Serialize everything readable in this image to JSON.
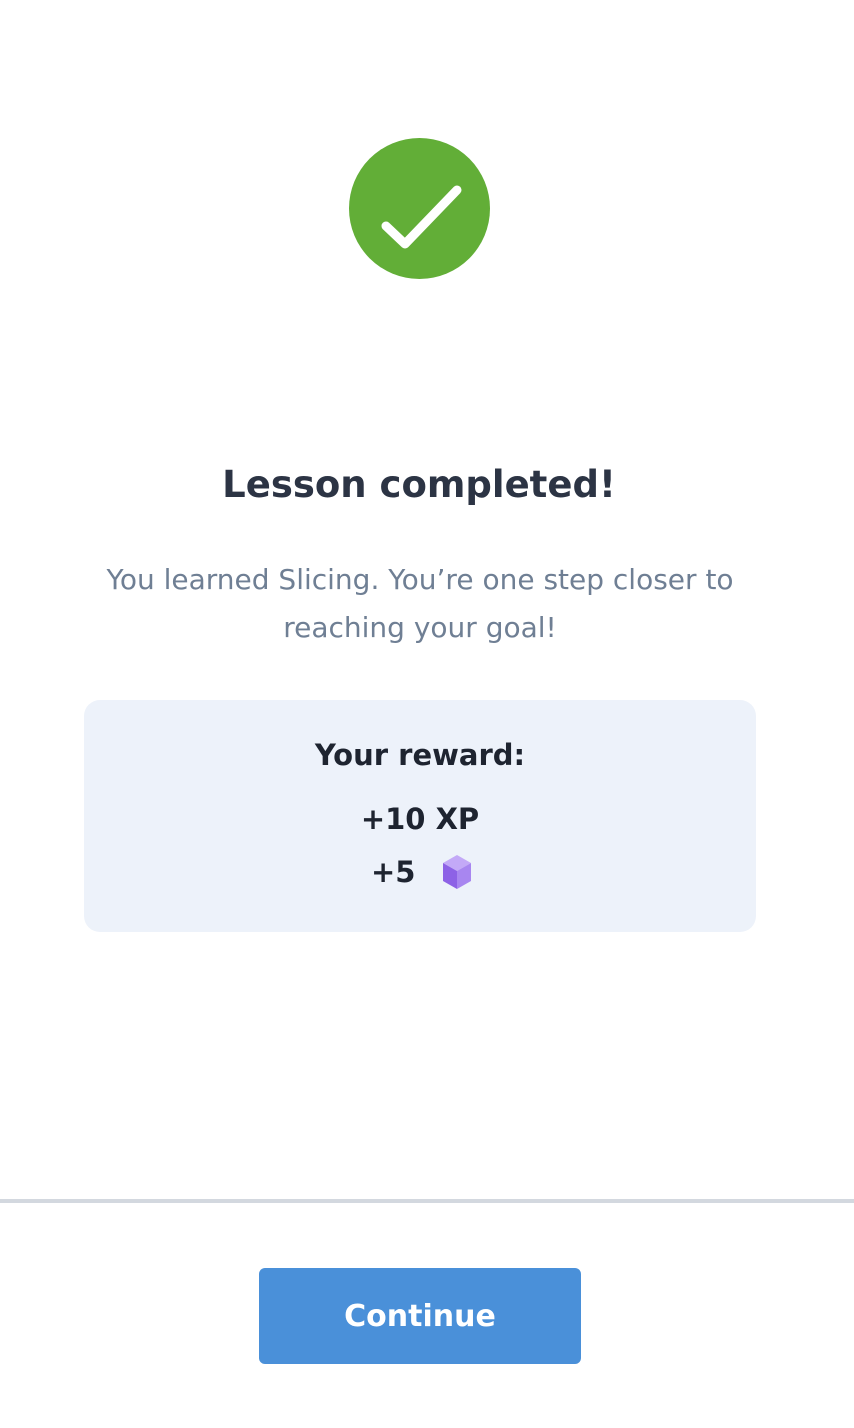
{
  "colors": {
    "success_green": "#62ae37",
    "button_blue": "#4a90d9",
    "card_background": "#edf2fa",
    "gem_purple": "#8d62e6"
  },
  "hero": {
    "icon": "checkmark-circle-icon"
  },
  "lesson": {
    "title": "Lesson completed!",
    "message": "You learned Slicing. You’re one step closer to reaching your goal!"
  },
  "reward": {
    "heading": "Your reward:",
    "xp": "+10 XP",
    "gems": "+5",
    "gem_icon": "gem-cube-icon"
  },
  "footer": {
    "continue_label": "Continue"
  }
}
